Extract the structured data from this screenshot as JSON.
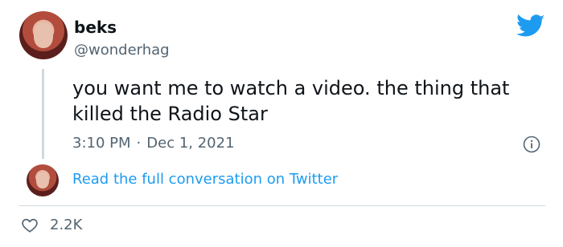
{
  "author": {
    "name": "beks",
    "handle": "@wonderhag",
    "avatar_icon": "profile-photo"
  },
  "tweet": {
    "text": "you want me to watch a video. the thing that killed the Radio Star",
    "time": "3:10 PM",
    "separator": "·",
    "date": "Dec 1, 2021"
  },
  "conversation_link": "Read the full conversation on Twitter",
  "likes": {
    "count": "2.2K",
    "icon": "heart-icon"
  },
  "colors": {
    "brand": "#1d9bf0",
    "muted": "#536471",
    "text": "#0f1419",
    "line": "#cfd9de"
  }
}
